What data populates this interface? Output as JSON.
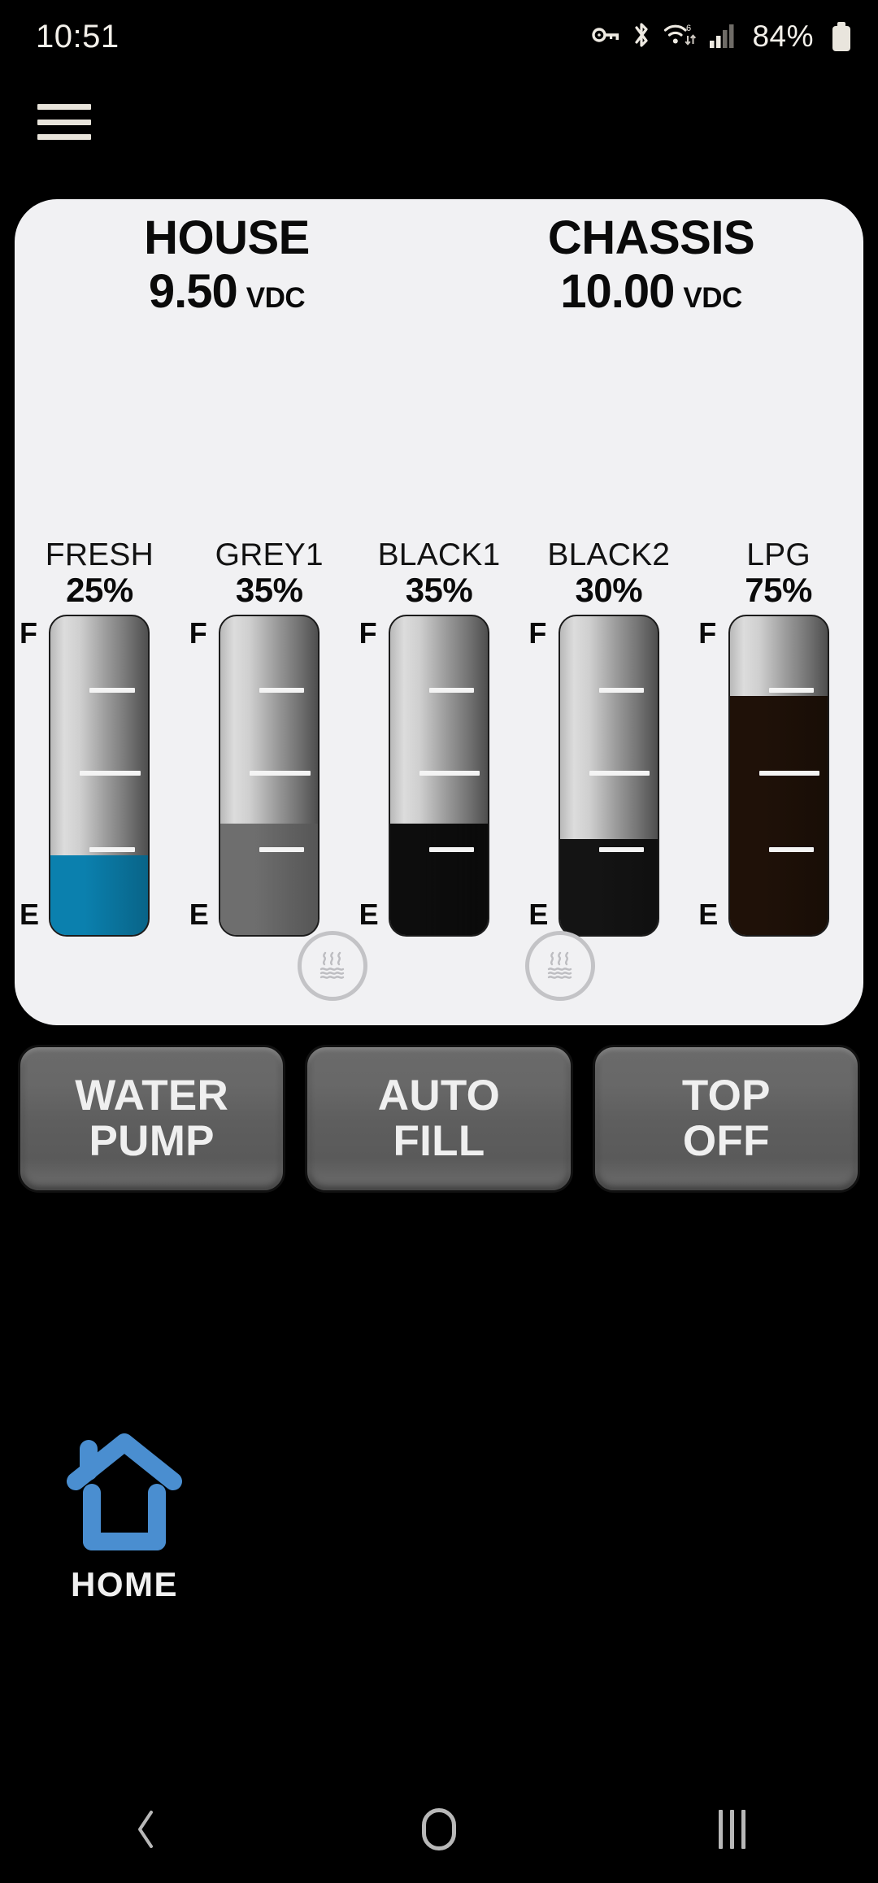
{
  "status_bar": {
    "clock": "10:51",
    "battery_percent": "84%",
    "icons": [
      "vpn-key-icon",
      "bluetooth-icon",
      "wifi-6-icon",
      "cellular-signal-icon",
      "battery-icon"
    ]
  },
  "app_bar": {
    "menu_icon": "hamburger-menu-icon"
  },
  "voltages": [
    {
      "title": "HOUSE",
      "value": "9.50",
      "unit": "VDC"
    },
    {
      "title": "CHASSIS",
      "value": "10.00",
      "unit": "VDC"
    }
  ],
  "gauge_scale": {
    "full": "F",
    "empty": "E"
  },
  "tanks": [
    {
      "name": "FRESH",
      "percent_label": "25%",
      "percent": 25,
      "fill_color": "#0b80ae",
      "has_heater": false
    },
    {
      "name": "GREY1",
      "percent_label": "35%",
      "percent": 35,
      "fill_color": "#6e6e6e",
      "has_heater": true
    },
    {
      "name": "BLACK1",
      "percent_label": "35%",
      "percent": 35,
      "fill_color": "#0d0d0d",
      "has_heater": false
    },
    {
      "name": "BLACK2",
      "percent_label": "30%",
      "percent": 30,
      "fill_color": "#141414",
      "has_heater": true
    },
    {
      "name": "LPG",
      "percent_label": "75%",
      "percent": 75,
      "fill_color": "#1f1108",
      "has_heater": false
    }
  ],
  "heater_icon_name": "tank-heater-pad-icon",
  "controls": [
    {
      "line1": "WATER",
      "line2": "PUMP"
    },
    {
      "line1": "AUTO",
      "line2": "FILL"
    },
    {
      "line1": "TOP",
      "line2": "OFF"
    }
  ],
  "home_nav": {
    "label": "HOME",
    "icon": "home-house-icon",
    "accent_color": "#4a8ed0"
  },
  "android_nav": {
    "back": "back-chevron-icon",
    "home": "home-circle-icon",
    "recents": "recents-icon"
  },
  "colors": {
    "background": "#000000",
    "panel": "#f1f1f3",
    "button": "#5e5e5e",
    "text_dark": "#0a0a0a",
    "text_light": "#efefef"
  }
}
